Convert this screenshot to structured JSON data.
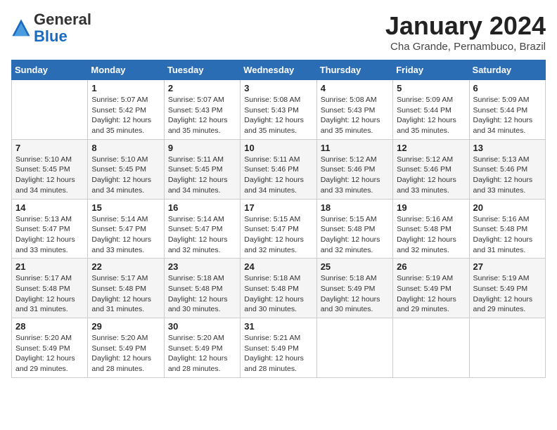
{
  "header": {
    "logo_general": "General",
    "logo_blue": "Blue",
    "month_title": "January 2024",
    "location": "Cha Grande, Pernambuco, Brazil"
  },
  "days_of_week": [
    "Sunday",
    "Monday",
    "Tuesday",
    "Wednesday",
    "Thursday",
    "Friday",
    "Saturday"
  ],
  "weeks": [
    [
      {
        "day": "",
        "info": ""
      },
      {
        "day": "1",
        "info": "Sunrise: 5:07 AM\nSunset: 5:42 PM\nDaylight: 12 hours\nand 35 minutes."
      },
      {
        "day": "2",
        "info": "Sunrise: 5:07 AM\nSunset: 5:43 PM\nDaylight: 12 hours\nand 35 minutes."
      },
      {
        "day": "3",
        "info": "Sunrise: 5:08 AM\nSunset: 5:43 PM\nDaylight: 12 hours\nand 35 minutes."
      },
      {
        "day": "4",
        "info": "Sunrise: 5:08 AM\nSunset: 5:43 PM\nDaylight: 12 hours\nand 35 minutes."
      },
      {
        "day": "5",
        "info": "Sunrise: 5:09 AM\nSunset: 5:44 PM\nDaylight: 12 hours\nand 35 minutes."
      },
      {
        "day": "6",
        "info": "Sunrise: 5:09 AM\nSunset: 5:44 PM\nDaylight: 12 hours\nand 34 minutes."
      }
    ],
    [
      {
        "day": "7",
        "info": "Sunrise: 5:10 AM\nSunset: 5:45 PM\nDaylight: 12 hours\nand 34 minutes."
      },
      {
        "day": "8",
        "info": "Sunrise: 5:10 AM\nSunset: 5:45 PM\nDaylight: 12 hours\nand 34 minutes."
      },
      {
        "day": "9",
        "info": "Sunrise: 5:11 AM\nSunset: 5:45 PM\nDaylight: 12 hours\nand 34 minutes."
      },
      {
        "day": "10",
        "info": "Sunrise: 5:11 AM\nSunset: 5:46 PM\nDaylight: 12 hours\nand 34 minutes."
      },
      {
        "day": "11",
        "info": "Sunrise: 5:12 AM\nSunset: 5:46 PM\nDaylight: 12 hours\nand 33 minutes."
      },
      {
        "day": "12",
        "info": "Sunrise: 5:12 AM\nSunset: 5:46 PM\nDaylight: 12 hours\nand 33 minutes."
      },
      {
        "day": "13",
        "info": "Sunrise: 5:13 AM\nSunset: 5:46 PM\nDaylight: 12 hours\nand 33 minutes."
      }
    ],
    [
      {
        "day": "14",
        "info": "Sunrise: 5:13 AM\nSunset: 5:47 PM\nDaylight: 12 hours\nand 33 minutes."
      },
      {
        "day": "15",
        "info": "Sunrise: 5:14 AM\nSunset: 5:47 PM\nDaylight: 12 hours\nand 33 minutes."
      },
      {
        "day": "16",
        "info": "Sunrise: 5:14 AM\nSunset: 5:47 PM\nDaylight: 12 hours\nand 32 minutes."
      },
      {
        "day": "17",
        "info": "Sunrise: 5:15 AM\nSunset: 5:47 PM\nDaylight: 12 hours\nand 32 minutes."
      },
      {
        "day": "18",
        "info": "Sunrise: 5:15 AM\nSunset: 5:48 PM\nDaylight: 12 hours\nand 32 minutes."
      },
      {
        "day": "19",
        "info": "Sunrise: 5:16 AM\nSunset: 5:48 PM\nDaylight: 12 hours\nand 32 minutes."
      },
      {
        "day": "20",
        "info": "Sunrise: 5:16 AM\nSunset: 5:48 PM\nDaylight: 12 hours\nand 31 minutes."
      }
    ],
    [
      {
        "day": "21",
        "info": "Sunrise: 5:17 AM\nSunset: 5:48 PM\nDaylight: 12 hours\nand 31 minutes."
      },
      {
        "day": "22",
        "info": "Sunrise: 5:17 AM\nSunset: 5:48 PM\nDaylight: 12 hours\nand 31 minutes."
      },
      {
        "day": "23",
        "info": "Sunrise: 5:18 AM\nSunset: 5:48 PM\nDaylight: 12 hours\nand 30 minutes."
      },
      {
        "day": "24",
        "info": "Sunrise: 5:18 AM\nSunset: 5:48 PM\nDaylight: 12 hours\nand 30 minutes."
      },
      {
        "day": "25",
        "info": "Sunrise: 5:18 AM\nSunset: 5:49 PM\nDaylight: 12 hours\nand 30 minutes."
      },
      {
        "day": "26",
        "info": "Sunrise: 5:19 AM\nSunset: 5:49 PM\nDaylight: 12 hours\nand 29 minutes."
      },
      {
        "day": "27",
        "info": "Sunrise: 5:19 AM\nSunset: 5:49 PM\nDaylight: 12 hours\nand 29 minutes."
      }
    ],
    [
      {
        "day": "28",
        "info": "Sunrise: 5:20 AM\nSunset: 5:49 PM\nDaylight: 12 hours\nand 29 minutes."
      },
      {
        "day": "29",
        "info": "Sunrise: 5:20 AM\nSunset: 5:49 PM\nDaylight: 12 hours\nand 28 minutes."
      },
      {
        "day": "30",
        "info": "Sunrise: 5:20 AM\nSunset: 5:49 PM\nDaylight: 12 hours\nand 28 minutes."
      },
      {
        "day": "31",
        "info": "Sunrise: 5:21 AM\nSunset: 5:49 PM\nDaylight: 12 hours\nand 28 minutes."
      },
      {
        "day": "",
        "info": ""
      },
      {
        "day": "",
        "info": ""
      },
      {
        "day": "",
        "info": ""
      }
    ]
  ]
}
